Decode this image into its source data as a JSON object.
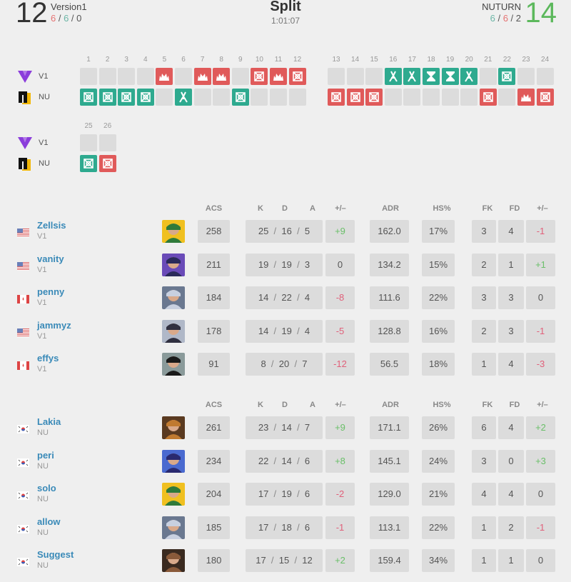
{
  "header": {
    "left_team": {
      "name": "Version1",
      "score": "12",
      "t_rounds": "6",
      "ct_rounds": "6",
      "ot_rounds": "0"
    },
    "right_team": {
      "name": "NUTURN",
      "score": "14",
      "ct_rounds": "6",
      "t_rounds": "6",
      "ot_rounds": "2"
    },
    "map": "Split",
    "duration": "1:01:07"
  },
  "teams": [
    {
      "tag": "V1",
      "logo": "v1-logo-icon",
      "color": "#8b3ddb"
    },
    {
      "tag": "NU",
      "logo": "nu-logo-icon",
      "color": "#f2b705"
    }
  ],
  "rounds": {
    "block1": {
      "numbers": [
        "1",
        "2",
        "3",
        "4",
        "5",
        "6",
        "7",
        "8",
        "9",
        "10",
        "11",
        "12"
      ],
      "v1": [
        "",
        "",
        "",
        "",
        "t-elim",
        "",
        "t-elim",
        "t-elim",
        "",
        "t-defuse",
        "t-elim",
        "t-defuse"
      ],
      "nu": [
        "ct-defuse",
        "ct-defuse",
        "ct-defuse",
        "ct-defuse",
        "",
        "ct-elim",
        "",
        "",
        "ct-defuse",
        "",
        "",
        ""
      ]
    },
    "block2": {
      "numbers": [
        "13",
        "14",
        "15",
        "16",
        "17",
        "18",
        "19",
        "20",
        "21",
        "22",
        "23",
        "24"
      ],
      "v1": [
        "",
        "",
        "",
        "ct-elim",
        "ct-elim",
        "ct-time",
        "ct-time",
        "ct-elim",
        "",
        "ct-defuse",
        "",
        ""
      ],
      "nu": [
        "t-defuse",
        "t-defuse",
        "t-defuse",
        "",
        "",
        "",
        "",
        "",
        "t-defuse",
        "",
        "t-elim",
        "t-defuse"
      ]
    },
    "block3": {
      "numbers": [
        "25",
        "26"
      ],
      "v1": [
        "",
        ""
      ],
      "nu": [
        "ct-defuse",
        "t-defuse"
      ]
    }
  },
  "columns": {
    "acs": "ACS",
    "k": "K",
    "d": "D",
    "a": "A",
    "pm": "+/–",
    "adr": "ADR",
    "hs": "HS%",
    "fk": "FK",
    "fd": "FD",
    "fpm": "+/–"
  },
  "team1_players": [
    {
      "name": "Zellsis",
      "team": "V1",
      "flag": "us",
      "agent": "killjoy",
      "acs": "258",
      "k": "25",
      "d": "16",
      "a": "5",
      "pm": "+9",
      "adr": "162.0",
      "hs": "17%",
      "fk": "3",
      "fd": "4",
      "fpm": "-1"
    },
    {
      "name": "vanity",
      "team": "V1",
      "flag": "us",
      "agent": "neon",
      "acs": "211",
      "k": "19",
      "d": "19",
      "a": "3",
      "pm": "0",
      "adr": "134.2",
      "hs": "15%",
      "fk": "2",
      "fd": "1",
      "fpm": "+1"
    },
    {
      "name": "penny",
      "team": "V1",
      "flag": "ca",
      "agent": "jett",
      "acs": "184",
      "k": "14",
      "d": "22",
      "a": "4",
      "pm": "-8",
      "adr": "111.6",
      "hs": "22%",
      "fk": "3",
      "fd": "3",
      "fpm": "0"
    },
    {
      "name": "jammyz",
      "team": "V1",
      "flag": "us",
      "agent": "sage",
      "acs": "178",
      "k": "14",
      "d": "19",
      "a": "4",
      "pm": "-5",
      "adr": "128.8",
      "hs": "16%",
      "fk": "2",
      "fd": "3",
      "fpm": "-1"
    },
    {
      "name": "effys",
      "team": "V1",
      "flag": "ca",
      "agent": "viper",
      "acs": "91",
      "k": "8",
      "d": "20",
      "a": "7",
      "pm": "-12",
      "adr": "56.5",
      "hs": "18%",
      "fk": "1",
      "fd": "4",
      "fpm": "-3"
    }
  ],
  "team2_players": [
    {
      "name": "Lakia",
      "team": "NU",
      "flag": "kr",
      "agent": "raze",
      "acs": "261",
      "k": "23",
      "d": "14",
      "a": "7",
      "pm": "+9",
      "adr": "171.1",
      "hs": "26%",
      "fk": "6",
      "fd": "4",
      "fpm": "+2"
    },
    {
      "name": "peri",
      "team": "NU",
      "flag": "kr",
      "agent": "omen",
      "acs": "234",
      "k": "22",
      "d": "14",
      "a": "6",
      "pm": "+8",
      "adr": "145.1",
      "hs": "24%",
      "fk": "3",
      "fd": "0",
      "fpm": "+3"
    },
    {
      "name": "solo",
      "team": "NU",
      "flag": "kr",
      "agent": "killjoy",
      "acs": "204",
      "k": "17",
      "d": "19",
      "a": "6",
      "pm": "-2",
      "adr": "129.0",
      "hs": "21%",
      "fk": "4",
      "fd": "4",
      "fpm": "0"
    },
    {
      "name": "allow",
      "team": "NU",
      "flag": "kr",
      "agent": "jett",
      "acs": "185",
      "k": "17",
      "d": "18",
      "a": "6",
      "pm": "-1",
      "adr": "113.1",
      "hs": "22%",
      "fk": "1",
      "fd": "2",
      "fpm": "-1"
    },
    {
      "name": "Suggest",
      "team": "NU",
      "flag": "kr",
      "agent": "kayo",
      "acs": "180",
      "k": "17",
      "d": "15",
      "a": "12",
      "pm": "+2",
      "adr": "159.4",
      "hs": "34%",
      "fk": "1",
      "fd": "1",
      "fpm": "0"
    }
  ]
}
